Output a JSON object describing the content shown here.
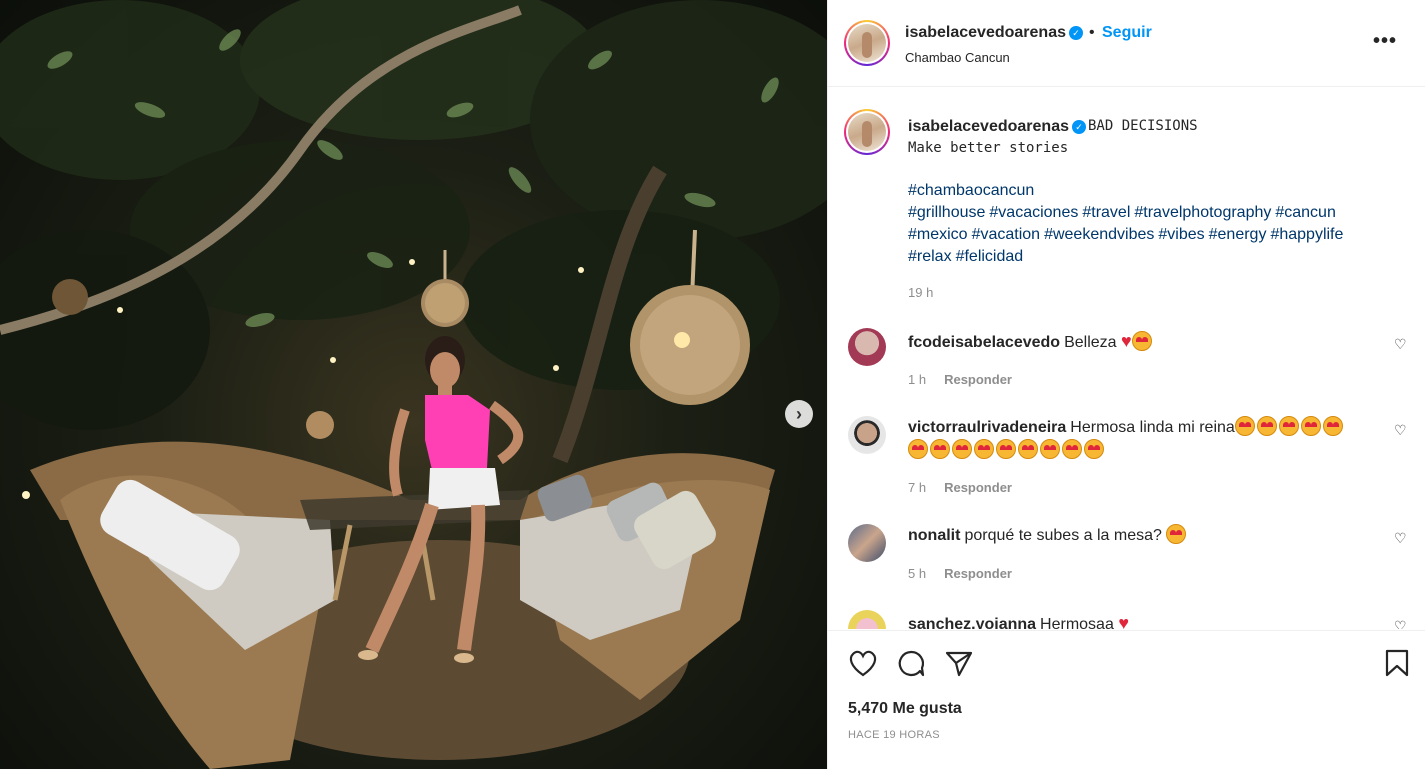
{
  "post": {
    "username": "isabelacevedoarenas",
    "follow_label": "Seguir",
    "separator": "•",
    "location": "Chambao Cancun",
    "more_label": "•••",
    "next_label": "›"
  },
  "caption": {
    "username": "isabelacevedoarenas",
    "title": "BAD DECISIONS",
    "line2": "Make better stories",
    "hashtags_line1": [
      "#chambaocancun"
    ],
    "hashtags_line2": [
      "#grillhouse",
      "#vacaciones",
      "#travel",
      "#travelphotography",
      "#cancun"
    ],
    "hashtags_line3": [
      "#mexico",
      "#vacation",
      "#weekendvibes",
      "#vibes",
      "#energy",
      "#happylife"
    ],
    "hashtags_line4": [
      "#relax",
      "#felicidad"
    ],
    "time": "19 h"
  },
  "comments": [
    {
      "username": "fcodeisabelacevedo",
      "text": "Belleza",
      "time": "1 h",
      "reply_label": "Responder"
    },
    {
      "username": "victorraulrivadeneira",
      "text": "Hermosa linda mi reina",
      "time": "7 h",
      "reply_label": "Responder"
    },
    {
      "username": "nonalit",
      "text": "porqué te subes a la mesa?",
      "time": "5 h",
      "reply_label": "Responder"
    },
    {
      "username": "sanchez.yojanna",
      "text": "Hermosaa"
    }
  ],
  "footer": {
    "likes": "5,470 Me gusta",
    "posted_ago": "HACE 19 HORAS"
  },
  "colors": {
    "accent": "#0095f6",
    "hashtag": "#00376b",
    "muted": "#8e8e8e",
    "top_bodysuit": "#ff3fb4"
  },
  "icons": [
    "verified-icon",
    "more-options-icon",
    "heart-icon",
    "comment-icon",
    "share-icon",
    "bookmark-icon",
    "next-arrow-icon"
  ]
}
